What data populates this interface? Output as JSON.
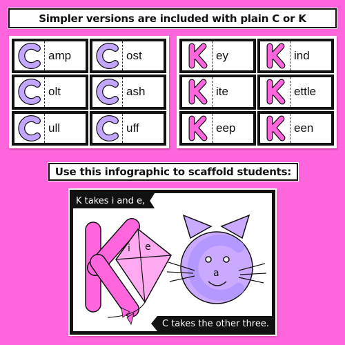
{
  "headers": {
    "top": "Simpler versions are included with plain C or K",
    "middle": "Use this infographic to scaffold students:"
  },
  "colors": {
    "background": "#ff66dd",
    "c_letter": "#c3a6ff",
    "k_letter": "#ff66dd",
    "kite": "#ffaaf0",
    "cat": "#c9aaff"
  },
  "c_cards": [
    {
      "letter": "C",
      "ending": "amp"
    },
    {
      "letter": "C",
      "ending": "ost"
    },
    {
      "letter": "C",
      "ending": "olt"
    },
    {
      "letter": "C",
      "ending": "ash"
    },
    {
      "letter": "C",
      "ending": "ull"
    },
    {
      "letter": "C",
      "ending": "uff"
    }
  ],
  "k_cards": [
    {
      "letter": "K",
      "ending": "ey"
    },
    {
      "letter": "K",
      "ending": "ind"
    },
    {
      "letter": "K",
      "ending": "ite"
    },
    {
      "letter": "K",
      "ending": "ettle"
    },
    {
      "letter": "K",
      "ending": "eep"
    },
    {
      "letter": "K",
      "ending": "een"
    }
  ],
  "infographic": {
    "k_rule": "K takes i and e,",
    "c_rule": "C takes the other three.",
    "kite_letters": [
      "i",
      "e"
    ],
    "cat_letter": "a"
  }
}
